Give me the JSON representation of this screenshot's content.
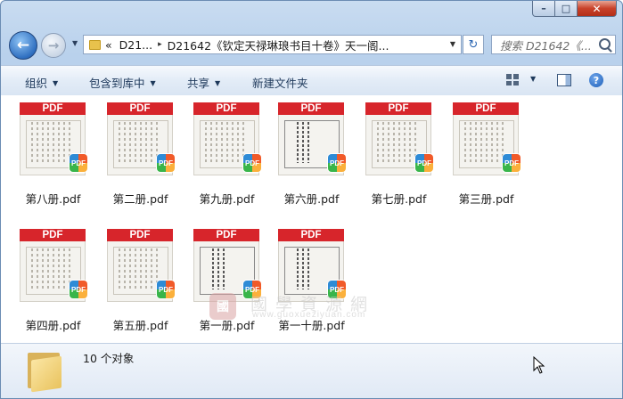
{
  "window": {
    "caption": {
      "minimize": "–",
      "maximize": "□",
      "close": "✕"
    }
  },
  "nav": {
    "back_glyph": "←",
    "forward_glyph": "→",
    "dropdown_glyph": "▼",
    "breadcrumb": {
      "overflow": "«",
      "items": [
        "D21...",
        "D21642《钦定天禄琳琅书目十卷》天一阁..."
      ],
      "separator": "▸"
    },
    "refresh_glyph": "↻",
    "search_placeholder": "搜索 D21642《..."
  },
  "toolbar": {
    "organize": "组织",
    "include_in_library": "包含到库中",
    "share": "共享",
    "new_folder": "新建文件夹",
    "arrow": "▼",
    "help": "?"
  },
  "files": [
    {
      "name": "第八册.pdf",
      "badge": "PDF",
      "thumb": "page"
    },
    {
      "name": "第二册.pdf",
      "badge": "PDF",
      "thumb": "page"
    },
    {
      "name": "第九册.pdf",
      "badge": "PDF",
      "thumb": "page"
    },
    {
      "name": "第六册.pdf",
      "badge": "PDF",
      "thumb": "cover"
    },
    {
      "name": "第七册.pdf",
      "badge": "PDF",
      "thumb": "page"
    },
    {
      "name": "第三册.pdf",
      "badge": "PDF",
      "thumb": "page"
    },
    {
      "name": "第四册.pdf",
      "badge": "PDF",
      "thumb": "page"
    },
    {
      "name": "第五册.pdf",
      "badge": "PDF",
      "thumb": "page"
    },
    {
      "name": "第一册.pdf",
      "badge": "PDF",
      "thumb": "cover"
    },
    {
      "name": "第一十册.pdf",
      "badge": "PDF",
      "thumb": "cover"
    }
  ],
  "watermark": {
    "seal": "國",
    "title": "國學資源網",
    "url": "www.guoxueziyuan.com"
  },
  "details": {
    "count": "10 个对象"
  },
  "colors": {
    "pdf_banner": "#d7252b",
    "chrome": "#c9dcf1"
  }
}
